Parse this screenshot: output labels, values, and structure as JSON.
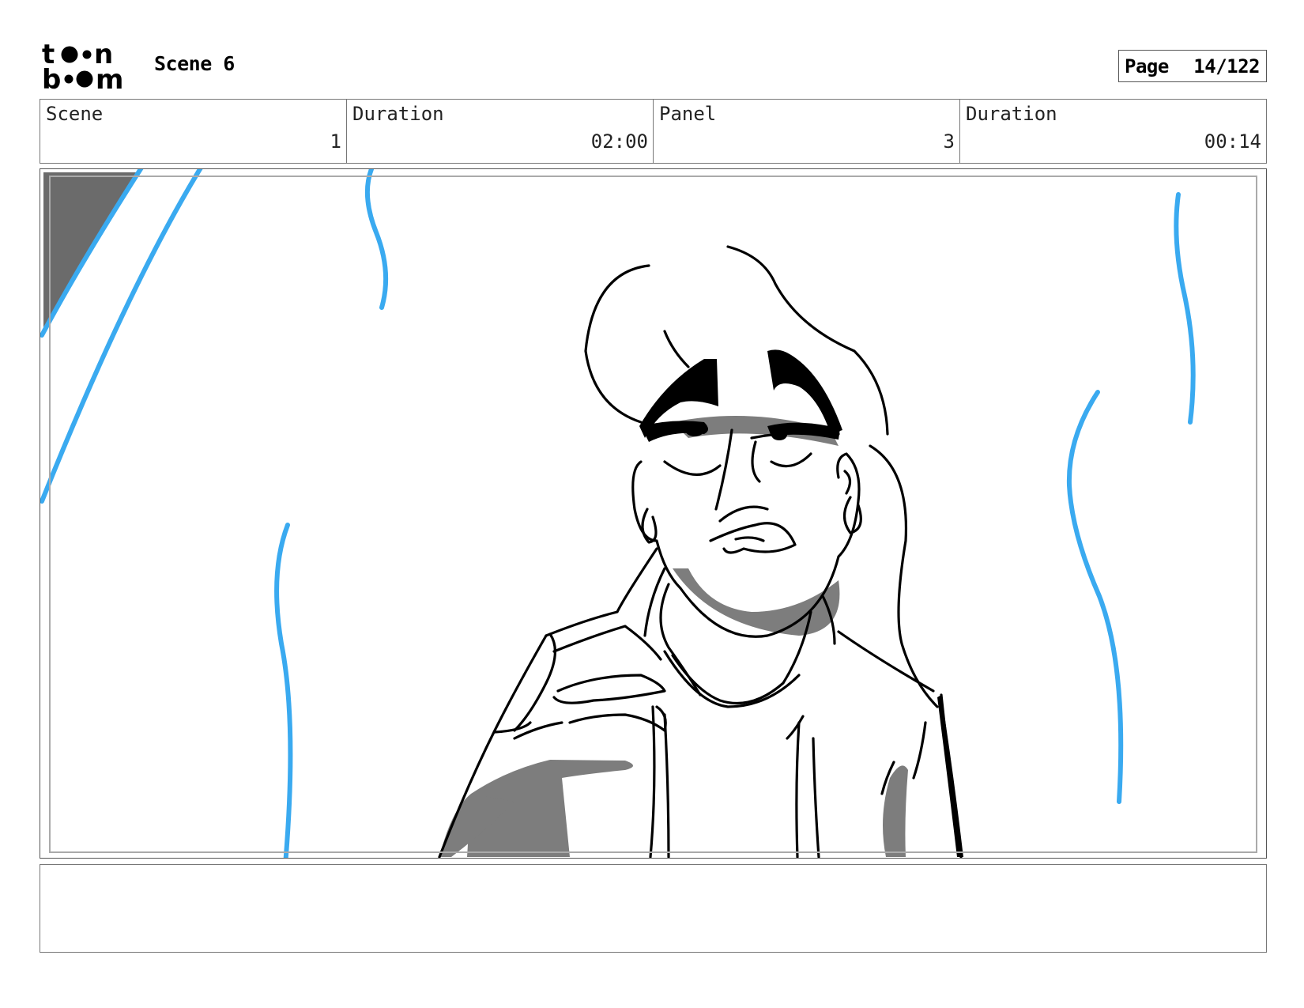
{
  "header": {
    "logo_text": "toon boom",
    "scene_title": "Scene 6",
    "page_label": "Page",
    "page_number": "14/122"
  },
  "info": {
    "scene_label": "Scene",
    "scene_value": "1",
    "scene_duration_label": "Duration",
    "scene_duration_value": "02:00",
    "panel_label": "Panel",
    "panel_value": "3",
    "panel_duration_label": "Duration",
    "panel_duration_value": "00:14"
  },
  "panel": {
    "colors": {
      "line": "#000000",
      "shadow": "#808080",
      "accent_blue": "#3aaaf0"
    }
  },
  "notes": {
    "text": ""
  }
}
